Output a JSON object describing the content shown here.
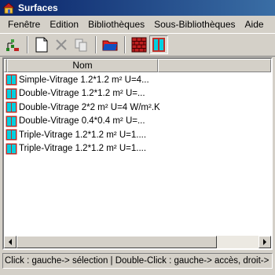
{
  "window": {
    "title": "Surfaces"
  },
  "menu": [
    "Fenêtre",
    "Edition",
    "Bibliothèques",
    "Sous-Bibliothèques",
    "Aide"
  ],
  "toolbar": {
    "buttons": [
      {
        "name": "tree-icon",
        "enabled": true
      },
      {
        "name": "new-document-icon",
        "enabled": true
      },
      {
        "name": "delete-icon",
        "enabled": false
      },
      {
        "name": "copy-icon",
        "enabled": false
      },
      {
        "name": "folder-red-icon",
        "enabled": true
      },
      {
        "name": "brick-wall-icon",
        "enabled": true
      },
      {
        "name": "window-icon",
        "enabled": true,
        "pressed": true
      }
    ]
  },
  "list": {
    "column_header": "Nom",
    "rows": [
      "Simple-Vitrage 1.2*1.2 m² U=4...",
      "Double-Vitrage 1.2*1.2 m² U=...",
      "Double-Vitrage 2*2 m² U=4 W/m².K",
      "Double-Vitrage 0.4*0.4 m² U=...",
      "Triple-Vitrage 1.2*1.2 m² U=1....",
      "Triple-Vitrage 1.2*1.2 m² U=1...."
    ],
    "row_icon": "window-icon"
  },
  "status": "Click : gauche-> sélection | Double-Click : gauche-> accès, droit-> édition",
  "colors": {
    "titlebar": "#0a246a",
    "window_frame": "#c0302a",
    "window_glass": "#00d0e0"
  }
}
